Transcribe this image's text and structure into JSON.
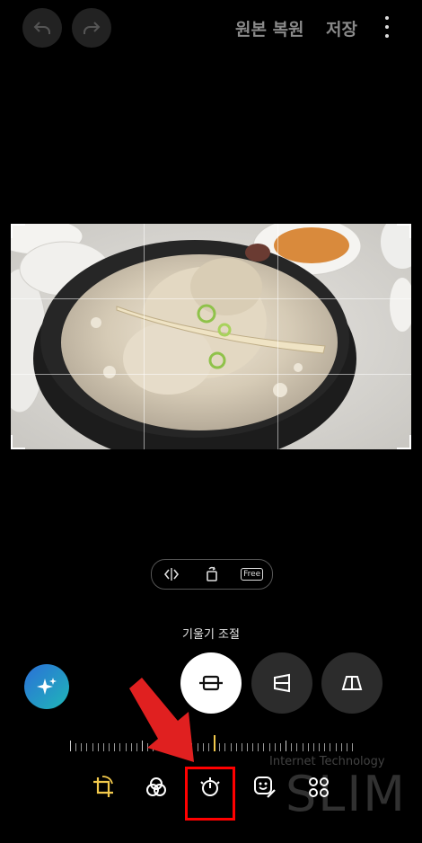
{
  "header": {
    "restore_label": "원본 복원",
    "save_label": "저장"
  },
  "transform_pill": {
    "free_label": "Free"
  },
  "tilt_label": "기울기 조절",
  "watermark": {
    "small": "Internet Technology",
    "big": "SLIM"
  },
  "colors": {
    "bottom_active": "#f2c94c",
    "highlight_box": "#ff0000",
    "arrow": "#e02020",
    "ai_gradient_start": "#2b6fd8",
    "ai_gradient_end": "#1fb7b8"
  }
}
